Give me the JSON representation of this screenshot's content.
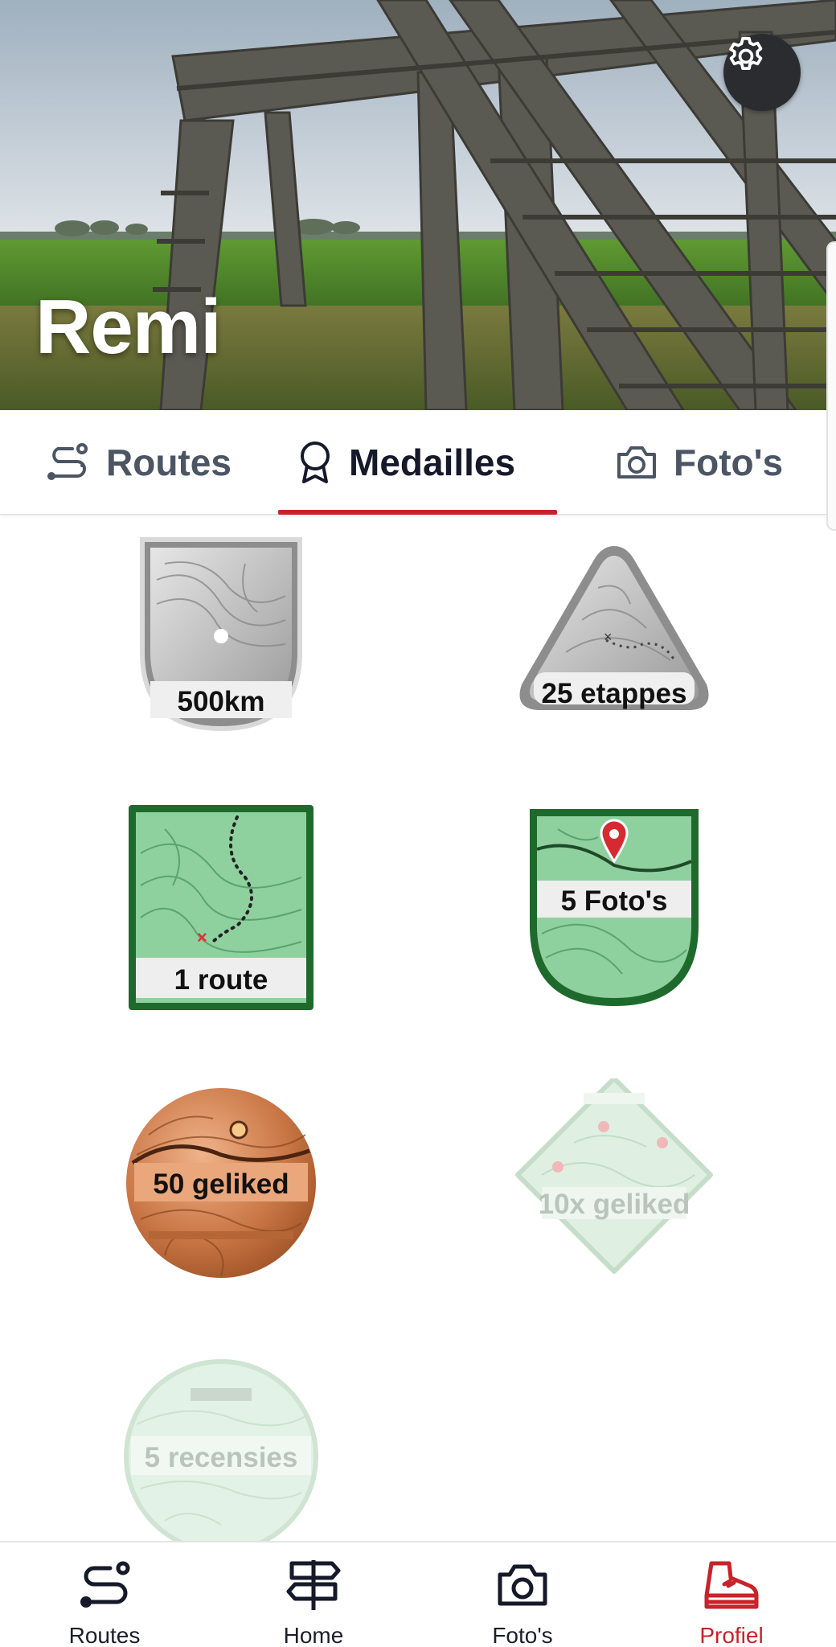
{
  "profile": {
    "name": "Remi"
  },
  "tabs": [
    {
      "label": "Routes",
      "icon": "routes-icon",
      "active": false
    },
    {
      "label": "Medailles",
      "icon": "medal-icon",
      "active": true
    },
    {
      "label": "Foto's",
      "icon": "camera-icon",
      "active": false
    }
  ],
  "medals": [
    {
      "label": "500km",
      "tier": "silver",
      "shape": "shield",
      "unlocked": true
    },
    {
      "label": "25 etappes",
      "tier": "silver",
      "shape": "triangle",
      "unlocked": true
    },
    {
      "label": "1 route",
      "tier": "green",
      "shape": "square",
      "unlocked": true
    },
    {
      "label": "5 Foto's",
      "tier": "green",
      "shape": "shield",
      "unlocked": true
    },
    {
      "label": "50 geliked",
      "tier": "bronze",
      "shape": "circle",
      "unlocked": true
    },
    {
      "label": "10x geliked",
      "tier": "green",
      "shape": "diamond",
      "unlocked": false
    },
    {
      "label": "5 recensies",
      "tier": "green",
      "shape": "circle",
      "unlocked": false
    }
  ],
  "bottom_nav": [
    {
      "label": "Routes",
      "icon": "routes-icon",
      "active": false
    },
    {
      "label": "Home",
      "icon": "signpost-icon",
      "active": false
    },
    {
      "label": "Foto's",
      "icon": "camera-icon",
      "active": false
    },
    {
      "label": "Profiel",
      "icon": "hiking-boot-icon",
      "active": true
    }
  ],
  "colors": {
    "accent": "#c8222b",
    "text": "#1b1f2b",
    "silver": "#b8b8b8",
    "green": "#7fc28f",
    "bronze": "#c07040"
  }
}
